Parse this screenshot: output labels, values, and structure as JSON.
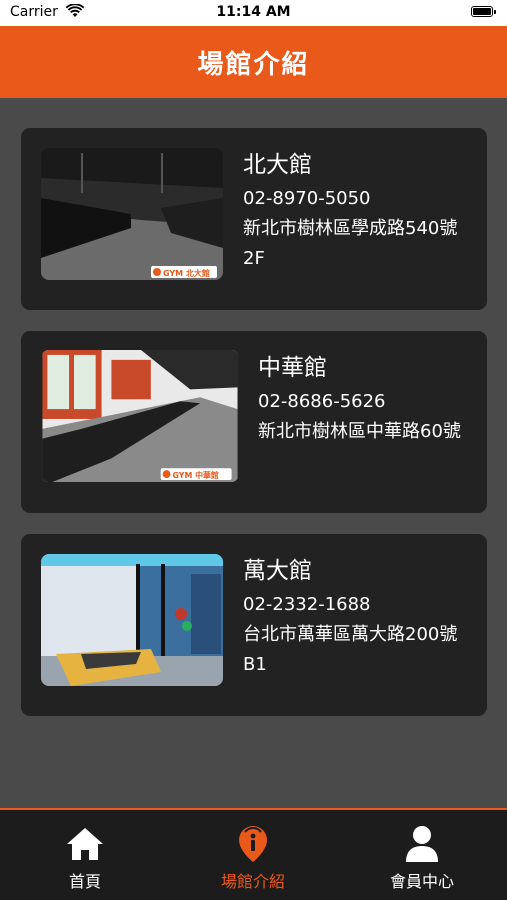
{
  "status_bar": {
    "carrier": "Carrier",
    "time": "11:14 AM"
  },
  "header": {
    "title": "場館介紹"
  },
  "venues": [
    {
      "name": "北大館",
      "phone": "02-8970-5050",
      "address": "新北市樹林區學成路540號2F",
      "photo_badge": "GYM 北大館"
    },
    {
      "name": "中華館",
      "phone": "02-8686-5626",
      "address": "新北市樹林區中華路60號",
      "photo_badge": "GYM 中華館"
    },
    {
      "name": "萬大館",
      "phone": "02-2332-1688",
      "address": "台北市萬華區萬大路200號B1",
      "photo_badge": ""
    }
  ],
  "tabs": [
    {
      "label": "首頁",
      "icon": "home-icon",
      "active": false
    },
    {
      "label": "場館介紹",
      "icon": "location-info-icon",
      "active": true
    },
    {
      "label": "會員中心",
      "icon": "person-icon",
      "active": false
    }
  ],
  "colors": {
    "accent": "#e8591a",
    "background": "#4a4a4a",
    "card": "#222222",
    "tabbar": "#1c1c1c"
  }
}
